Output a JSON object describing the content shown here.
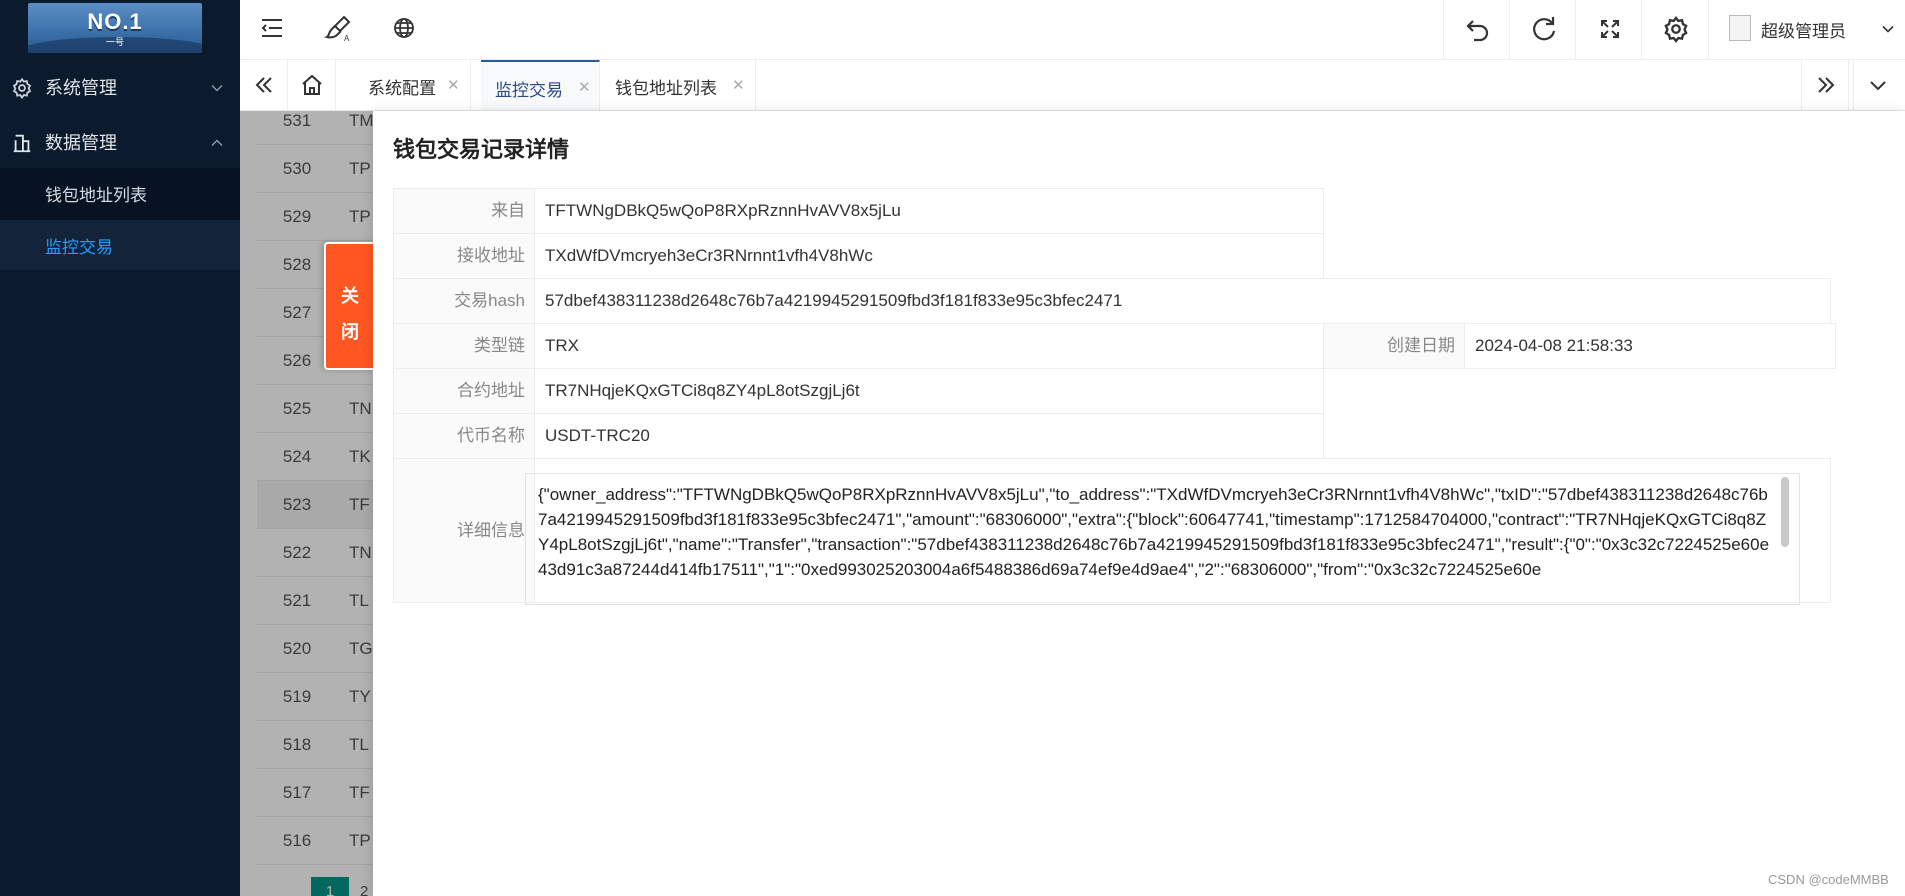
{
  "sidebar": {
    "logo_text": "NO.1",
    "logo_sub": "一号",
    "groups": [
      {
        "label": "系统管理"
      },
      {
        "label": "数据管理"
      }
    ],
    "subitems": [
      {
        "label": "钱包地址列表"
      },
      {
        "label": "监控交易"
      }
    ]
  },
  "header": {
    "user_name": "超级管理员"
  },
  "tabs": [
    {
      "label": "系统配置"
    },
    {
      "label": "监控交易"
    },
    {
      "label": "钱包地址列表"
    }
  ],
  "background_table": {
    "rows": [
      {
        "id": "531",
        "addr": "TM"
      },
      {
        "id": "530",
        "addr": "TP"
      },
      {
        "id": "529",
        "addr": "TP"
      },
      {
        "id": "528",
        "addr": ""
      },
      {
        "id": "527",
        "addr": ""
      },
      {
        "id": "526",
        "addr": ""
      },
      {
        "id": "525",
        "addr": "TN"
      },
      {
        "id": "524",
        "addr": "TK"
      },
      {
        "id": "523",
        "addr": "TF"
      },
      {
        "id": "522",
        "addr": "TN"
      },
      {
        "id": "521",
        "addr": "TL"
      },
      {
        "id": "520",
        "addr": "TG"
      },
      {
        "id": "519",
        "addr": "TY"
      },
      {
        "id": "518",
        "addr": "TL"
      },
      {
        "id": "517",
        "addr": "TF"
      },
      {
        "id": "516",
        "addr": "TP"
      }
    ],
    "pager_current": "1",
    "pager_next": "2"
  },
  "close_button": {
    "label_line1": "关",
    "label_line2": "闭"
  },
  "detail": {
    "title": "钱包交易记录详情",
    "from_label": "来自",
    "from_value": "TFTWNgDBkQ5wQoP8RXpRznnHvAVV8x5jLu",
    "to_label": "接收地址",
    "to_value": "TXdWfDVmcryeh3eCr3RNrnnt1vfh4V8hWc",
    "hash_label": "交易hash",
    "hash_value": "57dbef438311238d2648c76b7a4219945291509fbd3f181f833e95c3bfec2471",
    "chain_label": "类型链",
    "chain_value": "TRX",
    "date_label": "创建日期",
    "date_value": "2024-04-08 21:58:33",
    "contract_label": "合约地址",
    "contract_value": "TR7NHqjeKQxGTCi8q8ZY4pL8otSzgjLj6t",
    "token_label": "代币名称",
    "token_value": "USDT-TRC20",
    "info_label": "详细信息",
    "info_value": "{\"owner_address\":\"TFTWNgDBkQ5wQoP8RXpRznnHvAVV8x5jLu\",\"to_address\":\"TXdWfDVmcryeh3eCr3RNrnnt1vfh4V8hWc\",\"txID\":\"57dbef438311238d2648c76b7a4219945291509fbd3f181f833e95c3bfec2471\",\"amount\":\"68306000\",\"extra\":{\"block\":60647741,\"timestamp\":1712584704000,\"contract\":\"TR7NHqjeKQxGTCi8q8ZY4pL8otSzgjLj6t\",\"name\":\"Transfer\",\"transaction\":\"57dbef438311238d2648c76b7a4219945291509fbd3f181f833e95c3bfec2471\",\"result\":{\"0\":\"0x3c32c7224525e60e43d91c3a87244d414fb17511\",\"1\":\"0xed993025203004a6f5488386d69a74ef9e4d9ae4\",\"2\":\"68306000\",\"from\":\"0x3c32c7224525e60e"
  },
  "watermark": "CSDN @codeMMBB"
}
